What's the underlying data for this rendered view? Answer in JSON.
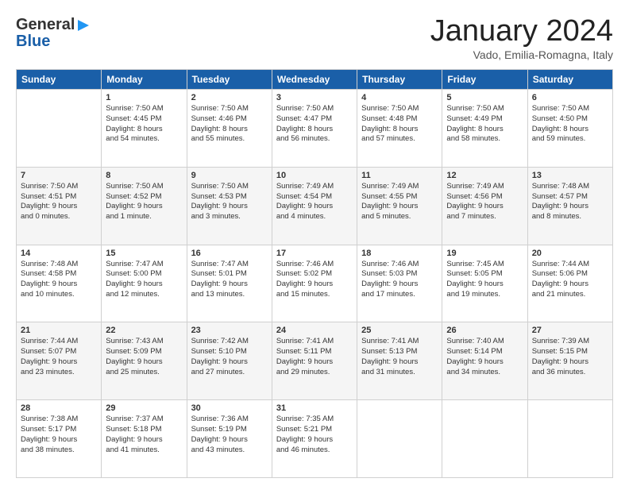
{
  "logo": {
    "line1": "General",
    "line2": "Blue"
  },
  "header": {
    "title": "January 2024",
    "location": "Vado, Emilia-Romagna, Italy"
  },
  "days_of_week": [
    "Sunday",
    "Monday",
    "Tuesday",
    "Wednesday",
    "Thursday",
    "Friday",
    "Saturday"
  ],
  "weeks": [
    [
      {
        "day": "",
        "info": ""
      },
      {
        "day": "1",
        "info": "Sunrise: 7:50 AM\nSunset: 4:45 PM\nDaylight: 8 hours\nand 54 minutes."
      },
      {
        "day": "2",
        "info": "Sunrise: 7:50 AM\nSunset: 4:46 PM\nDaylight: 8 hours\nand 55 minutes."
      },
      {
        "day": "3",
        "info": "Sunrise: 7:50 AM\nSunset: 4:47 PM\nDaylight: 8 hours\nand 56 minutes."
      },
      {
        "day": "4",
        "info": "Sunrise: 7:50 AM\nSunset: 4:48 PM\nDaylight: 8 hours\nand 57 minutes."
      },
      {
        "day": "5",
        "info": "Sunrise: 7:50 AM\nSunset: 4:49 PM\nDaylight: 8 hours\nand 58 minutes."
      },
      {
        "day": "6",
        "info": "Sunrise: 7:50 AM\nSunset: 4:50 PM\nDaylight: 8 hours\nand 59 minutes."
      }
    ],
    [
      {
        "day": "7",
        "info": "Sunrise: 7:50 AM\nSunset: 4:51 PM\nDaylight: 9 hours\nand 0 minutes."
      },
      {
        "day": "8",
        "info": "Sunrise: 7:50 AM\nSunset: 4:52 PM\nDaylight: 9 hours\nand 1 minute."
      },
      {
        "day": "9",
        "info": "Sunrise: 7:50 AM\nSunset: 4:53 PM\nDaylight: 9 hours\nand 3 minutes."
      },
      {
        "day": "10",
        "info": "Sunrise: 7:49 AM\nSunset: 4:54 PM\nDaylight: 9 hours\nand 4 minutes."
      },
      {
        "day": "11",
        "info": "Sunrise: 7:49 AM\nSunset: 4:55 PM\nDaylight: 9 hours\nand 5 minutes."
      },
      {
        "day": "12",
        "info": "Sunrise: 7:49 AM\nSunset: 4:56 PM\nDaylight: 9 hours\nand 7 minutes."
      },
      {
        "day": "13",
        "info": "Sunrise: 7:48 AM\nSunset: 4:57 PM\nDaylight: 9 hours\nand 8 minutes."
      }
    ],
    [
      {
        "day": "14",
        "info": "Sunrise: 7:48 AM\nSunset: 4:58 PM\nDaylight: 9 hours\nand 10 minutes."
      },
      {
        "day": "15",
        "info": "Sunrise: 7:47 AM\nSunset: 5:00 PM\nDaylight: 9 hours\nand 12 minutes."
      },
      {
        "day": "16",
        "info": "Sunrise: 7:47 AM\nSunset: 5:01 PM\nDaylight: 9 hours\nand 13 minutes."
      },
      {
        "day": "17",
        "info": "Sunrise: 7:46 AM\nSunset: 5:02 PM\nDaylight: 9 hours\nand 15 minutes."
      },
      {
        "day": "18",
        "info": "Sunrise: 7:46 AM\nSunset: 5:03 PM\nDaylight: 9 hours\nand 17 minutes."
      },
      {
        "day": "19",
        "info": "Sunrise: 7:45 AM\nSunset: 5:05 PM\nDaylight: 9 hours\nand 19 minutes."
      },
      {
        "day": "20",
        "info": "Sunrise: 7:44 AM\nSunset: 5:06 PM\nDaylight: 9 hours\nand 21 minutes."
      }
    ],
    [
      {
        "day": "21",
        "info": "Sunrise: 7:44 AM\nSunset: 5:07 PM\nDaylight: 9 hours\nand 23 minutes."
      },
      {
        "day": "22",
        "info": "Sunrise: 7:43 AM\nSunset: 5:09 PM\nDaylight: 9 hours\nand 25 minutes."
      },
      {
        "day": "23",
        "info": "Sunrise: 7:42 AM\nSunset: 5:10 PM\nDaylight: 9 hours\nand 27 minutes."
      },
      {
        "day": "24",
        "info": "Sunrise: 7:41 AM\nSunset: 5:11 PM\nDaylight: 9 hours\nand 29 minutes."
      },
      {
        "day": "25",
        "info": "Sunrise: 7:41 AM\nSunset: 5:13 PM\nDaylight: 9 hours\nand 31 minutes."
      },
      {
        "day": "26",
        "info": "Sunrise: 7:40 AM\nSunset: 5:14 PM\nDaylight: 9 hours\nand 34 minutes."
      },
      {
        "day": "27",
        "info": "Sunrise: 7:39 AM\nSunset: 5:15 PM\nDaylight: 9 hours\nand 36 minutes."
      }
    ],
    [
      {
        "day": "28",
        "info": "Sunrise: 7:38 AM\nSunset: 5:17 PM\nDaylight: 9 hours\nand 38 minutes."
      },
      {
        "day": "29",
        "info": "Sunrise: 7:37 AM\nSunset: 5:18 PM\nDaylight: 9 hours\nand 41 minutes."
      },
      {
        "day": "30",
        "info": "Sunrise: 7:36 AM\nSunset: 5:19 PM\nDaylight: 9 hours\nand 43 minutes."
      },
      {
        "day": "31",
        "info": "Sunrise: 7:35 AM\nSunset: 5:21 PM\nDaylight: 9 hours\nand 46 minutes."
      },
      {
        "day": "",
        "info": ""
      },
      {
        "day": "",
        "info": ""
      },
      {
        "day": "",
        "info": ""
      }
    ]
  ]
}
